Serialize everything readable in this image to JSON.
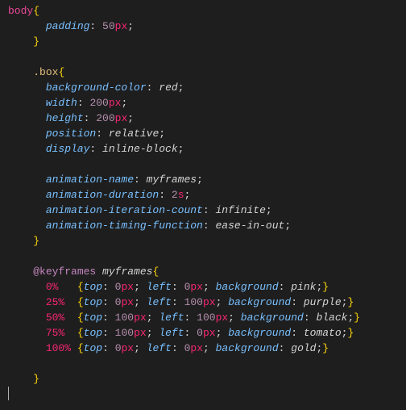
{
  "code": {
    "body_selector": "body",
    "body_rules": [
      {
        "prop": "padding",
        "num": "50",
        "unit": "px"
      }
    ],
    "box_selector": ".box",
    "box_rules_1": [
      {
        "prop": "background-color",
        "value": "red"
      },
      {
        "prop": "width",
        "num": "200",
        "unit": "px"
      },
      {
        "prop": "height",
        "num": "200",
        "unit": "px"
      },
      {
        "prop": "position",
        "value": "relative"
      },
      {
        "prop": "display",
        "value": "inline-block"
      }
    ],
    "box_rules_2": [
      {
        "prop": "animation-name",
        "value": "myframes"
      },
      {
        "prop": "animation-duration",
        "num": "2",
        "unit": "s"
      },
      {
        "prop": "animation-iteration-count",
        "value": "infinite"
      },
      {
        "prop": "animation-timing-function",
        "value": "ease-in-out"
      }
    ],
    "keyframes_at": "@keyframes",
    "keyframes_name": "myframes",
    "keyframes": [
      {
        "pct": "0%",
        "pad": "   ",
        "top_n": "0",
        "left_n": "0",
        "bg": "pink"
      },
      {
        "pct": "25%",
        "pad": "  ",
        "top_n": "0",
        "left_n": "100",
        "bg": "purple"
      },
      {
        "pct": "50%",
        "pad": "  ",
        "top_n": "100",
        "left_n": "100",
        "bg": "black"
      },
      {
        "pct": "75%",
        "pad": "  ",
        "top_n": "100",
        "left_n": "0",
        "bg": "tomato"
      },
      {
        "pct": "100%",
        "pad": " ",
        "top_n": "0",
        "left_n": "0",
        "bg": "gold"
      }
    ]
  }
}
